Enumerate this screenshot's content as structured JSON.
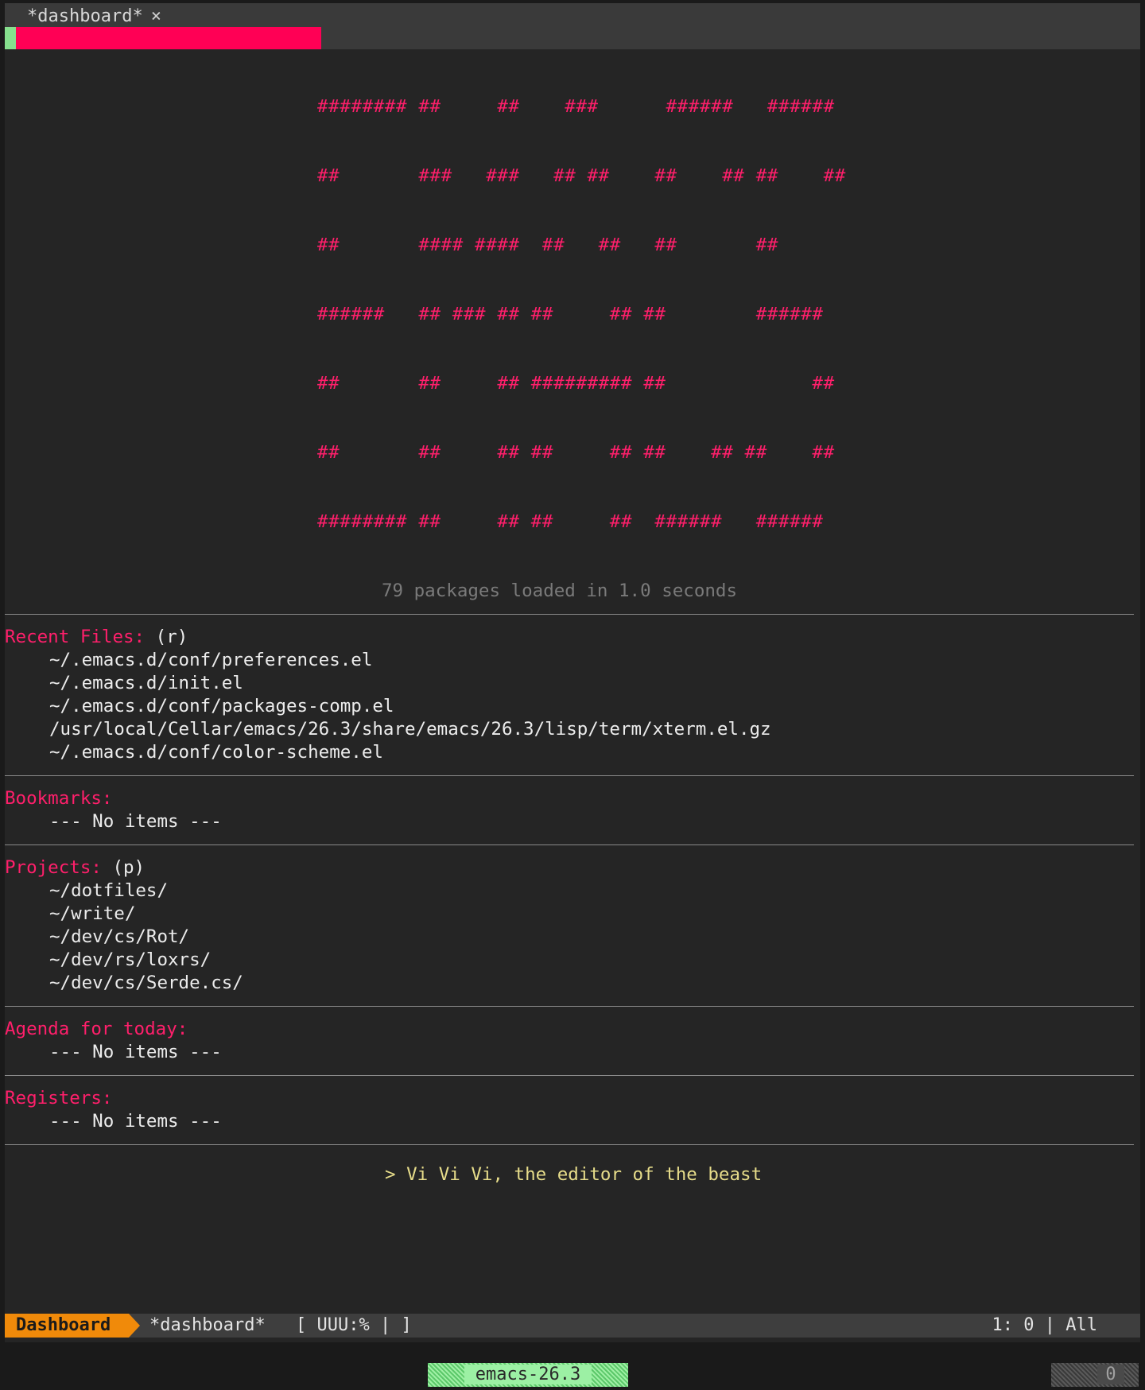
{
  "tab": {
    "title": "*dashboard*",
    "close": "×"
  },
  "banner": [
    "######## ##     ##    ###      ######   ######",
    "##       ###   ###   ## ##    ##    ## ##    ##",
    "##       #### ####  ##   ##   ##       ##",
    "######   ## ### ## ##     ## ##        ######",
    "##       ##     ## ######### ##             ##",
    "##       ##     ## ##     ## ##    ## ##    ##",
    "######## ##     ## ##     ##  ######   ######"
  ],
  "loaded_text": "79 packages loaded in 1.0 seconds",
  "recent_files": {
    "heading": "Recent Files:",
    "shortcut": "(r)",
    "items": [
      "~/.emacs.d/conf/preferences.el",
      "~/.emacs.d/init.el",
      "~/.emacs.d/conf/packages-comp.el",
      "/usr/local/Cellar/emacs/26.3/share/emacs/26.3/lisp/term/xterm.el.gz",
      "~/.emacs.d/conf/color-scheme.el"
    ]
  },
  "bookmarks": {
    "heading": "Bookmarks:",
    "empty": "--- No items ---"
  },
  "projects": {
    "heading": "Projects:",
    "shortcut": "(p)",
    "items": [
      "~/dotfiles/",
      "~/write/",
      "~/dev/cs/Rot/",
      "~/dev/rs/loxrs/",
      "~/dev/cs/Serde.cs/"
    ]
  },
  "agenda": {
    "heading": "Agenda for today:",
    "empty": "--- No items ---"
  },
  "registers": {
    "heading": "Registers:",
    "empty": "--- No items ---"
  },
  "quote": "> Vi Vi Vi, the editor of the beast",
  "modeline": {
    "mode_name": "Dashboard",
    "buffer": "*dashboard*",
    "status": "[ UUU:% | ]",
    "position": "1: 0 | All"
  },
  "wm": {
    "label": "emacs-26.3",
    "counter": "0"
  },
  "colors": {
    "accent": "#ff1f6b",
    "mode_orange": "#f08a0a",
    "quote_yellow": "#e6dc8a",
    "wm_green": "#9cf0a4"
  }
}
